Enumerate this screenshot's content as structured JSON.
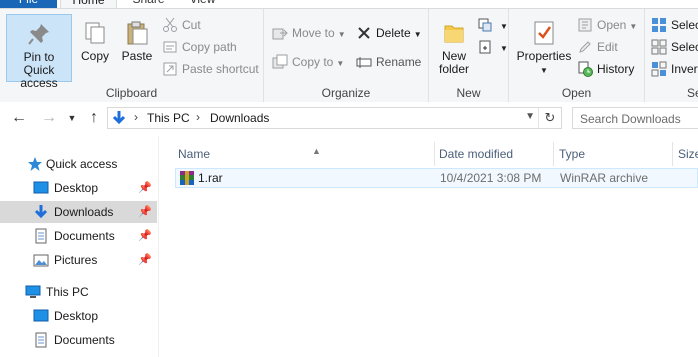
{
  "tabs": {
    "file": "File",
    "home": "Home",
    "share": "Share",
    "view": "View"
  },
  "ribbon": {
    "clipboard": {
      "label": "Clipboard",
      "pin": "Pin to Quick access",
      "pin_line1": "Pin to Quick",
      "pin_line2": "access",
      "copy": "Copy",
      "paste": "Paste",
      "cut": "Cut",
      "copy_path": "Copy path",
      "paste_shortcut": "Paste shortcut"
    },
    "organize": {
      "label": "Organize",
      "move_to": "Move to",
      "copy_to": "Copy to",
      "delete": "Delete",
      "rename": "Rename"
    },
    "new": {
      "label": "New",
      "new_folder_line1": "New",
      "new_folder_line2": "folder"
    },
    "open": {
      "label": "Open",
      "properties": "Properties",
      "open": "Open",
      "edit": "Edit",
      "history": "History"
    },
    "select": {
      "label": "Se",
      "select_all": "Selec",
      "select_none": "Selec",
      "invert": "Invert"
    }
  },
  "address": {
    "segments": [
      "This PC",
      "Downloads"
    ],
    "search_placeholder": "Search Downloads"
  },
  "navpane": {
    "items": [
      {
        "label": "Quick access",
        "icon": "star-icon"
      },
      {
        "label": "Desktop",
        "icon": "desktop-icon",
        "pinned": true
      },
      {
        "label": "Downloads",
        "icon": "download-icon",
        "pinned": true,
        "selected": true
      },
      {
        "label": "Documents",
        "icon": "documents-icon",
        "pinned": true
      },
      {
        "label": "Pictures",
        "icon": "pictures-icon",
        "pinned": true
      },
      {
        "label": "This PC",
        "icon": "computer-icon"
      },
      {
        "label": "Desktop",
        "icon": "desktop-icon"
      },
      {
        "label": "Documents",
        "icon": "documents-icon"
      }
    ]
  },
  "filelist": {
    "columns": [
      "Name",
      "Date modified",
      "Type",
      "Size"
    ],
    "rows": [
      {
        "name": "1.rar",
        "date": "10/4/2021 3:08 PM",
        "type": "WinRAR archive",
        "icon": "winrar-icon"
      }
    ]
  },
  "colors": {
    "accent": "#1a67b8",
    "selected_bg": "#cce4f7",
    "nav_selected": "#d9d9d9",
    "header_text": "#4c607a"
  }
}
